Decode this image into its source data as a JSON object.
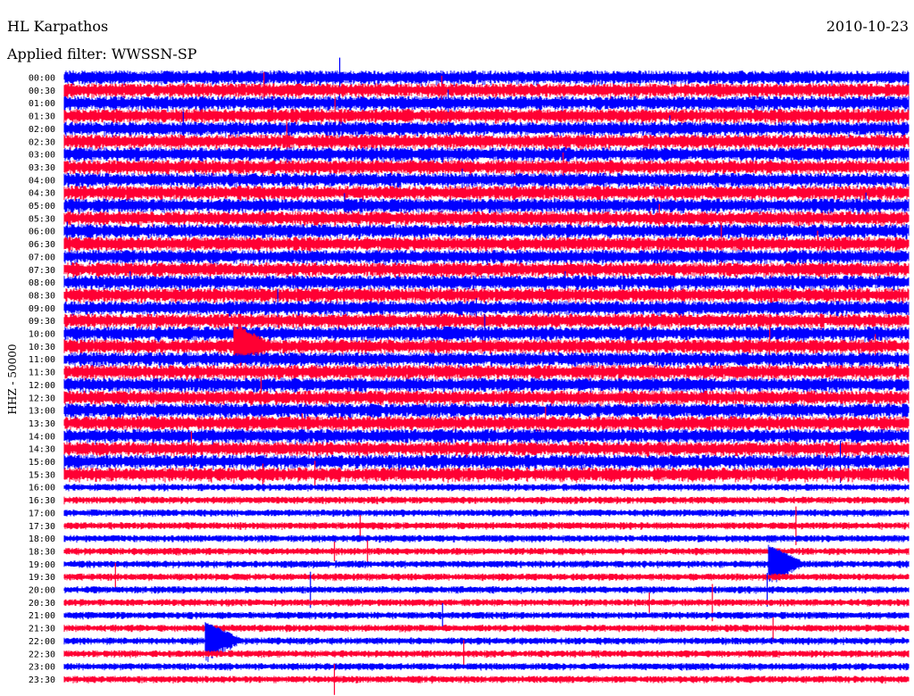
{
  "header": {
    "title": "HL Karpathos",
    "filter": "Applied filter: WWSSN-SP",
    "date": "2010-10-23"
  },
  "chart_data": {
    "type": "line",
    "title": "HL Karpathos",
    "subtitle": "Applied filter: WWSSN-SP",
    "date": "2010-10-23",
    "ylabel": "HHZ - 50000",
    "rows": [
      "00:00",
      "00:30",
      "01:00",
      "01:30",
      "02:00",
      "02:30",
      "03:00",
      "03:30",
      "04:00",
      "04:30",
      "05:00",
      "05:30",
      "06:00",
      "06:30",
      "07:00",
      "07:30",
      "08:00",
      "08:30",
      "09:00",
      "09:30",
      "10:00",
      "10:30",
      "11:00",
      "11:30",
      "12:00",
      "12:30",
      "13:00",
      "13:30",
      "14:00",
      "14:30",
      "15:00",
      "15:30",
      "16:00",
      "16:30",
      "17:00",
      "17:30",
      "18:00",
      "18:30",
      "19:00",
      "19:30",
      "20:00",
      "20:30",
      "21:00",
      "21:30",
      "22:00",
      "22:30",
      "23:00",
      "23:30"
    ],
    "series_colors": [
      "#0000ff",
      "#ff0033"
    ],
    "events": [
      {
        "time": "10:30",
        "offset_min": 6
      },
      {
        "time": "19:00",
        "offset_min": 25
      },
      {
        "time": "22:00",
        "offset_min": 5
      }
    ]
  }
}
